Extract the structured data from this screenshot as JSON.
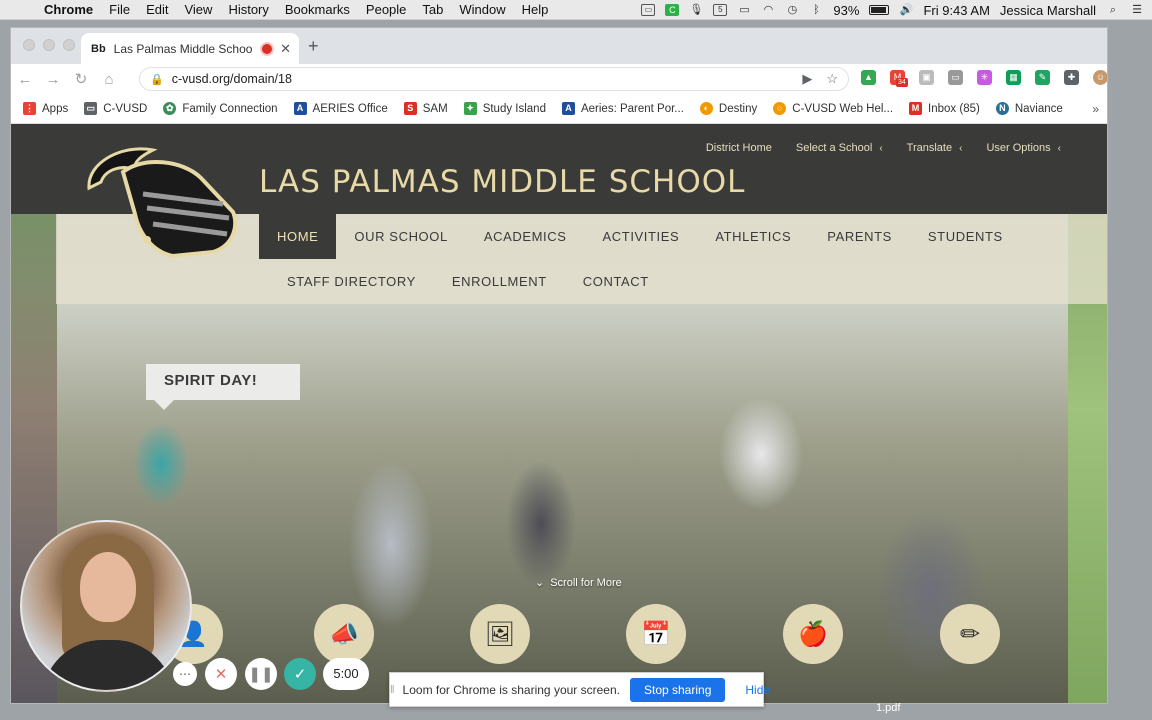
{
  "menubar": {
    "app": "Chrome",
    "items": [
      "File",
      "Edit",
      "View",
      "History",
      "Bookmarks",
      "People",
      "Tab",
      "Window",
      "Help"
    ],
    "battery": "93%",
    "clock": "Fri 9:43 AM",
    "user": "Jessica Marshall"
  },
  "browser": {
    "tab_title": "Las Palmas Middle Schoo",
    "tab_favicon": "Bb",
    "url": "c-vusd.org/domain/18",
    "gmail_badge": "34",
    "bookmarks": [
      {
        "label": "Apps",
        "icon": "apps-grid-icon",
        "color": "#ea4335"
      },
      {
        "label": "C-VUSD",
        "icon": "folder-icon",
        "color": "#5f6368"
      },
      {
        "label": "Family Connection",
        "icon": "globe-icon",
        "color": "#3c8b5a"
      },
      {
        "label": "AERIES Office",
        "icon": "aeries-icon",
        "color": "#1f4e9c"
      },
      {
        "label": "SAM",
        "icon": "sam-icon",
        "color": "#d93025"
      },
      {
        "label": "Study Island",
        "icon": "study-island-icon",
        "color": "#37a34a"
      },
      {
        "label": "Aeries: Parent Por...",
        "icon": "aeries-icon",
        "color": "#1f4e9c"
      },
      {
        "label": "Destiny",
        "icon": "destiny-icon",
        "color": "#f29900"
      },
      {
        "label": "C-VUSD Web Hel...",
        "icon": "web-help-icon",
        "color": "#f29900"
      },
      {
        "label": "Inbox (85)",
        "icon": "gmail-icon",
        "color": "#d93025"
      },
      {
        "label": "Naviance",
        "icon": "naviance-icon",
        "color": "#2a6f97"
      }
    ]
  },
  "site": {
    "title": "LAS PALMAS MIDDLE SCHOOL",
    "utility": [
      "District Home",
      "Select a School",
      "Translate",
      "User Options"
    ],
    "nav_row1": [
      "HOME",
      "OUR SCHOOL",
      "ACADEMICS",
      "ACTIVITIES",
      "ATHLETICS",
      "PARENTS",
      "STUDENTS"
    ],
    "nav_row2": [
      "STAFF DIRECTORY",
      "ENROLLMENT",
      "CONTACT"
    ],
    "slide_caption": "SPIRIT DAY!",
    "scroll_label": "Scroll for More"
  },
  "loom": {
    "timer": "5:00",
    "share_message": "Loom for Chrome is sharing your screen.",
    "stop_label": "Stop sharing",
    "hide_label": "Hide"
  },
  "desktop": {
    "file_label": "1.pdf"
  }
}
